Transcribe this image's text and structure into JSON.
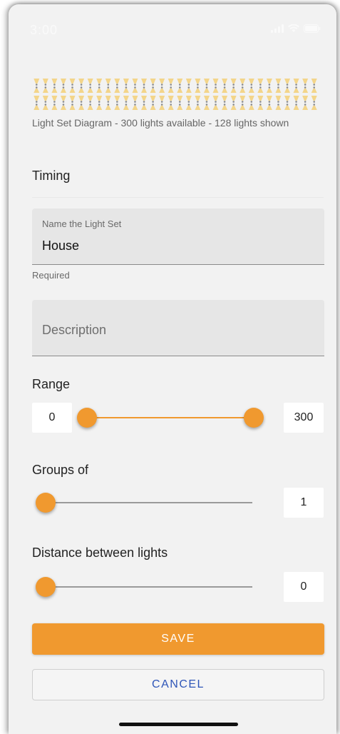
{
  "status_bar": {
    "time": "3:00"
  },
  "diagram": {
    "caption": "Light Set Diagram - 300 lights available - 128 lights shown",
    "columns": 32,
    "rows": 4,
    "bulb_color": "#f3d58a",
    "socket_color": "#8a8a8a"
  },
  "timing": {
    "title": "Timing"
  },
  "name_field": {
    "label": "Name the Light Set",
    "value": "House",
    "helper": "Required"
  },
  "description_field": {
    "placeholder": "Description"
  },
  "range": {
    "title": "Range",
    "min_value": "0",
    "max_value": "300",
    "range_min": 0,
    "range_max": 300
  },
  "groups": {
    "title": "Groups of",
    "value": "1",
    "fraction": 0
  },
  "distance": {
    "title": "Distance between lights",
    "value": "0",
    "fraction": 0
  },
  "actions": {
    "save_label": "SAVE",
    "cancel_label": "CANCEL"
  },
  "colors": {
    "accent": "#f0992f",
    "cancel_text": "#2f56b8",
    "background": "#f2f2f2"
  }
}
